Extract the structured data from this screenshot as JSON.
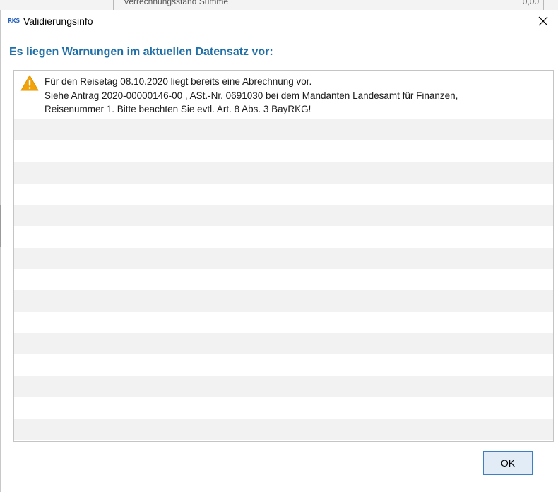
{
  "backdrop": {
    "cell_label": "Verrechnungsstand Summe",
    "cell_value": "0,00"
  },
  "dialog": {
    "app_icon_text": "RKS",
    "title": "Validierungsinfo",
    "close_icon": "close-icon",
    "heading": "Es liegen Warnungen im aktuellen Datensatz vor:",
    "warnings": [
      {
        "icon": "warning-icon",
        "lines": [
          "Für den Reisetag 08.10.2020 liegt bereits eine Abrechnung vor.",
          "Siehe Antrag 2020-00000146-00 , ASt.-Nr. 0691030 bei dem Mandanten Landesamt für Finanzen,",
          "Reisenummer 1. Bitte beachten Sie evtl. Art. 8 Abs. 3 BayRKG!"
        ]
      }
    ],
    "ok_label": "OK"
  },
  "colors": {
    "heading": "#1f6fa8",
    "warning_icon": "#f0a30a",
    "ok_border": "#3c7fc4",
    "ok_fill": "#e1ecf7",
    "row_alt": "#f2f2f2"
  }
}
